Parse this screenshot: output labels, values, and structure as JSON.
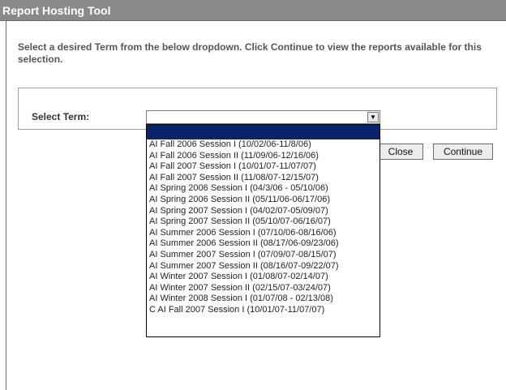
{
  "header": {
    "title": "Report Hosting Tool"
  },
  "instructions": "Select a desired Term from the below dropdown. Click Continue to view the reports available for this selection.",
  "term_select": {
    "label": "Select Term:",
    "selected": "",
    "arrow_icon": "▼",
    "options": [
      "AI Fall 2006 Session I (10/02/06-11/8/06)",
      "AI Fall 2006 Session II (11/09/06-12/16/06)",
      "AI Fall 2007 Session I (10/01/07-11/07/07)",
      "AI Fall 2007 Session II (11/08/07-12/15/07)",
      "AI Spring 2006 Session I (04/3/06 - 05/10/06)",
      "AI Spring 2006 Session II (05/11/06-06/17/06)",
      "AI Spring 2007 Session I (04/02/07-05/09/07)",
      "AI Spring 2007 Session II (05/10/07-06/16/07)",
      "AI Summer 2006 Session I (07/10/06-08/16/06)",
      "AI Summer 2006 Session II (08/17/06-09/23/06)",
      "AI Summer 2007 Session I (07/09/07-08/15/07)",
      "AI Summer 2007 Session II (08/16/07-09/22/07)",
      "AI Winter 2007 Session I (01/08/07-02/14/07)",
      "AI Winter 2007 Session II (02/15/07-03/24/07)",
      "AI Winter 2008 Session I (01/07/08 - 02/13/08)",
      "C AI Fall 2007 Session I (10/01/07-11/07/07)"
    ]
  },
  "buttons": {
    "close": "Close",
    "continue": "Continue"
  }
}
